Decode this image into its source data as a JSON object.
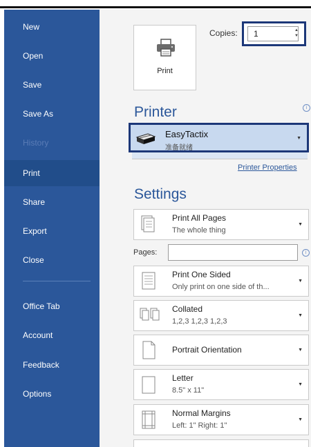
{
  "sidebar": {
    "items": [
      {
        "label": "New"
      },
      {
        "label": "Open"
      },
      {
        "label": "Save"
      },
      {
        "label": "Save As"
      },
      {
        "label": "History"
      },
      {
        "label": "Print"
      },
      {
        "label": "Share"
      },
      {
        "label": "Export"
      },
      {
        "label": "Close"
      },
      {
        "label": "Office Tab"
      },
      {
        "label": "Account"
      },
      {
        "label": "Feedback"
      },
      {
        "label": "Options"
      }
    ]
  },
  "print": {
    "button_label": "Print",
    "copies_label": "Copies:",
    "copies_value": "1"
  },
  "printer": {
    "section_title": "Printer",
    "name": "EasyTactix",
    "status": "准备就绪",
    "properties_link": "Printer Properties"
  },
  "settings": {
    "section_title": "Settings",
    "pages_label": "Pages:",
    "pages_value": "",
    "print_pages": {
      "main": "Print All Pages",
      "sub": "The whole thing"
    },
    "sides": {
      "main": "Print One Sided",
      "sub": "Only print on one side of th..."
    },
    "collation": {
      "main": "Collated",
      "sub": "1,2,3   1,2,3   1,2,3"
    },
    "orientation": {
      "main": "Portrait Orientation"
    },
    "paper": {
      "main": "Letter",
      "sub": "8.5\" x 11\""
    },
    "margins": {
      "main": "Normal Margins",
      "sub": "Left:  1\"   Right:  1\""
    }
  },
  "colors": {
    "sidebar": "#2b579a",
    "highlight_border": "#1c3778",
    "printer_select_bg": "#c8d9ef"
  }
}
